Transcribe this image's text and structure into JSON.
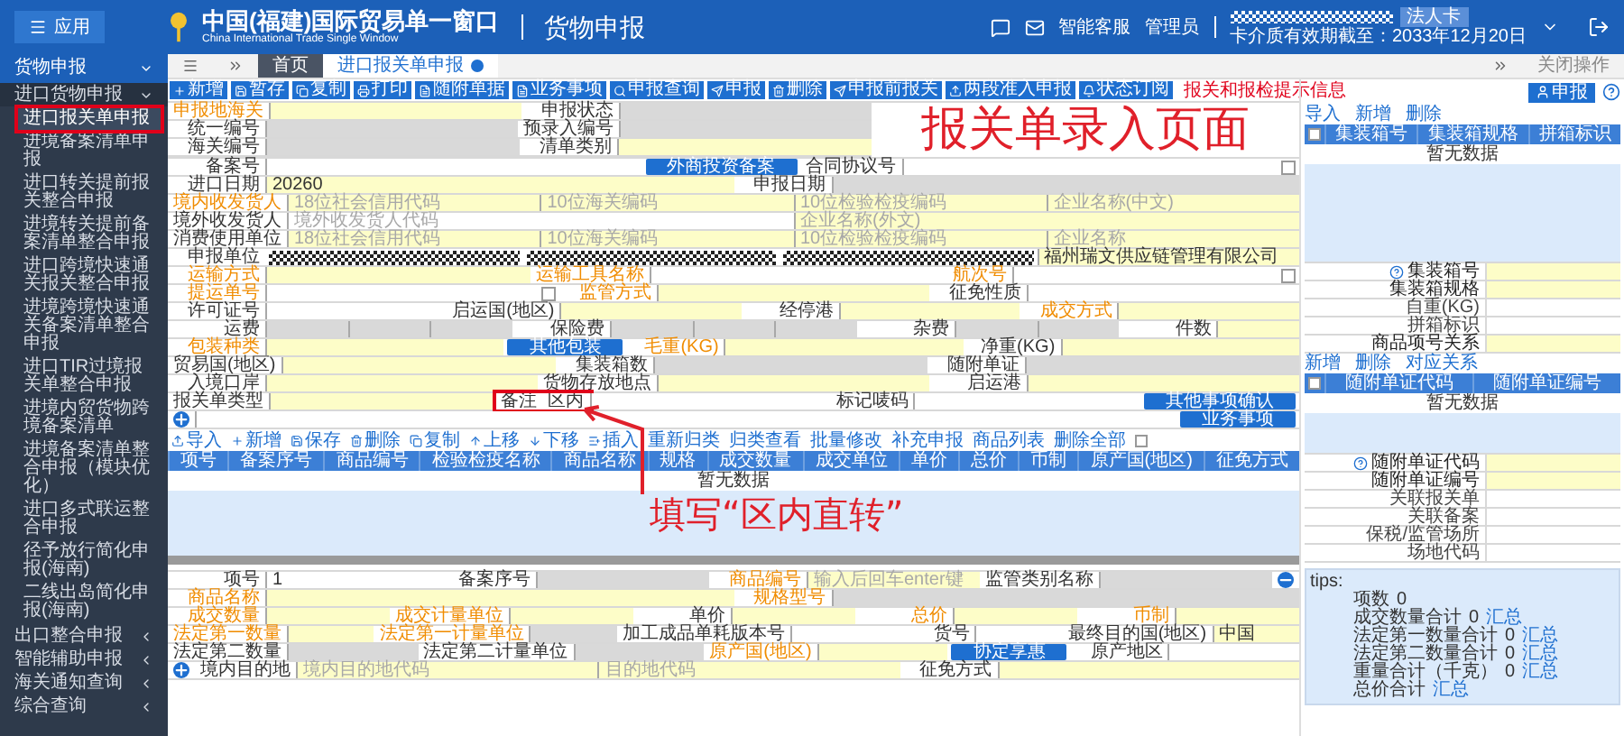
{
  "header": {
    "menu_button": "应用",
    "title": "中国(福建)国际贸易单一窗口",
    "subtitle": "China International Trade Single Window",
    "module": "货物申报",
    "links": [
      "智能客服",
      "管理员"
    ],
    "user_badge": "法人卡",
    "expiry": "卡介质有效期截至：2033年12月20日"
  },
  "sidebar": {
    "title": "货物申报",
    "groups": [
      {
        "label": "进口货物申报",
        "expanded": true,
        "items": [
          {
            "label": "进口报关单申报",
            "selected": true,
            "highlight": true
          },
          {
            "label": "进境备案清单申报",
            "selected": false,
            "highlight": false
          },
          {
            "label": "进口转关提前报关整合申报",
            "selected": false,
            "highlight": false
          },
          {
            "label": "进境转关提前备案清单整合申报",
            "selected": false,
            "highlight": false
          },
          {
            "label": "进口跨境快速通关报关整合申报",
            "selected": false,
            "highlight": false
          },
          {
            "label": "进境跨境快速通关备案清单整合申报",
            "selected": false,
            "highlight": false
          },
          {
            "label": "进口TIR过境报关单整合申报",
            "selected": false,
            "highlight": false
          },
          {
            "label": "进境内贸货物跨境备案清单",
            "selected": false,
            "highlight": false
          },
          {
            "label": "进境备案清单整合申报（模块优化）",
            "selected": false,
            "highlight": false
          },
          {
            "label": "进口多式联运整合申报",
            "selected": false,
            "highlight": false
          },
          {
            "label": "径予放行简化申报(海南)",
            "selected": false,
            "highlight": false
          },
          {
            "label": "二线出岛简化申报(海南)",
            "selected": false,
            "highlight": false
          }
        ]
      },
      {
        "label": "出口整合申报",
        "expanded": false
      },
      {
        "label": "智能辅助申报",
        "expanded": false
      },
      {
        "label": "海关通知查询",
        "expanded": false
      },
      {
        "label": "综合查询",
        "expanded": false
      }
    ]
  },
  "tabs": [
    {
      "label": "首页",
      "selected": false,
      "closable": false
    },
    {
      "label": "进口报关单申报",
      "selected": true,
      "closable": true
    }
  ],
  "close_action": "关闭操作",
  "toolbar": [
    "新增",
    "暂存",
    "复制",
    "打印",
    "随附单据",
    "业务事项",
    "申报查询",
    "申报",
    "删除",
    "申报前报关",
    "两段准入申报",
    "状态订阅"
  ],
  "notice": "报关和报检提示信息",
  "form_rows": [
    [
      {
        "kind": "label",
        "text": "申报地海关",
        "required": true
      },
      {
        "kind": "field",
        "required": true,
        "disabled": false
      },
      {
        "kind": "label",
        "text": "申报状态",
        "required": false
      },
      {
        "kind": "field",
        "required": false,
        "disabled": true
      }
    ],
    [
      {
        "kind": "label",
        "text": "统一编号",
        "required": false
      },
      {
        "kind": "field",
        "required": false,
        "disabled": true
      },
      {
        "kind": "label",
        "text": "预录入编号",
        "required": false
      },
      {
        "kind": "field",
        "required": false,
        "disabled": true
      }
    ],
    [
      {
        "kind": "label",
        "text": "海关编号",
        "required": false
      },
      {
        "kind": "field",
        "required": false,
        "disabled": true
      },
      {
        "kind": "label",
        "text": "清单类别",
        "required": false
      },
      {
        "kind": "field",
        "required": true,
        "disabled": false
      }
    ],
    [
      {
        "kind": "label",
        "text": "备案号",
        "required": false
      },
      {
        "kind": "field",
        "required": false,
        "disabled": false
      },
      {
        "kind": "button",
        "text": "外商投资备案"
      },
      {
        "kind": "label",
        "text": "合同协议号",
        "required": false
      },
      {
        "kind": "field",
        "required": false,
        "disabled": false
      },
      {
        "kind": "checkbox",
        "checked": false
      }
    ],
    [
      {
        "kind": "label",
        "text": "进口日期",
        "required": false
      },
      {
        "kind": "field",
        "required": true,
        "disabled": false,
        "value": "20260"
      },
      {
        "kind": "label",
        "text": "申报日期",
        "required": false
      },
      {
        "kind": "field",
        "required": false,
        "disabled": true
      }
    ],
    [
      {
        "kind": "label",
        "text": "境内收发货人",
        "required": true
      },
      {
        "kind": "field",
        "required": true,
        "disabled": false,
        "placeholder": "18位社会信用代码"
      },
      {
        "kind": "field",
        "required": true,
        "disabled": false,
        "placeholder": "10位海关编码"
      },
      {
        "kind": "field",
        "required": true,
        "disabled": false,
        "placeholder": "10位检验检疫编码"
      },
      {
        "kind": "field",
        "required": true,
        "disabled": false,
        "placeholder": "企业名称(中文)"
      }
    ],
    [
      {
        "kind": "label",
        "text": "境外收发货人",
        "required": false
      },
      {
        "kind": "field",
        "required": false,
        "disabled": false,
        "placeholder": "境外收发货人代码"
      },
      {
        "kind": "field",
        "required": true,
        "disabled": false,
        "placeholder": "企业名称(外文)"
      }
    ],
    [
      {
        "kind": "label",
        "text": "消费使用单位",
        "required": false
      },
      {
        "kind": "field",
        "required": true,
        "disabled": false,
        "placeholder": "18位社会信用代码"
      },
      {
        "kind": "field",
        "required": true,
        "disabled": false,
        "placeholder": "10位海关编码"
      },
      {
        "kind": "field",
        "required": true,
        "disabled": false,
        "placeholder": "10位检验检疫编码"
      },
      {
        "kind": "field",
        "required": true,
        "disabled": false,
        "placeholder": "企业名称"
      }
    ],
    [
      {
        "kind": "label",
        "text": "申报单位",
        "required": false
      },
      {
        "kind": "mask"
      },
      {
        "kind": "mask"
      },
      {
        "kind": "mask"
      },
      {
        "kind": "field",
        "required": true,
        "disabled": false,
        "value": "福州瑞文供应链管理有限公司"
      }
    ],
    [
      {
        "kind": "label",
        "text": "运输方式",
        "required": true
      },
      {
        "kind": "field",
        "required": true,
        "disabled": false
      },
      {
        "kind": "label",
        "text": "运输工具名称",
        "required": true
      },
      {
        "kind": "field",
        "required": false,
        "disabled": false
      },
      {
        "kind": "label",
        "text": "航次号",
        "required": true
      },
      {
        "kind": "field",
        "required": false,
        "disabled": false
      },
      {
        "kind": "checkbox",
        "checked": false
      }
    ],
    [
      {
        "kind": "label",
        "text": "提运单号",
        "required": true
      },
      {
        "kind": "field",
        "required": false,
        "disabled": false
      },
      {
        "kind": "checkbox",
        "checked": false
      },
      {
        "kind": "label",
        "text": "监管方式",
        "required": true
      },
      {
        "kind": "field",
        "required": true,
        "disabled": false
      },
      {
        "kind": "label",
        "text": "征免性质",
        "required": false
      },
      {
        "kind": "field",
        "required": false,
        "disabled": false
      }
    ],
    [
      {
        "kind": "label",
        "text": "许可证号",
        "required": false
      },
      {
        "kind": "field",
        "required": false,
        "disabled": false
      },
      {
        "kind": "label",
        "text": "启运国(地区)",
        "required": false
      },
      {
        "kind": "field",
        "required": true,
        "disabled": false
      },
      {
        "kind": "label",
        "text": "经停港",
        "required": false
      },
      {
        "kind": "field",
        "required": true,
        "disabled": false
      },
      {
        "kind": "label",
        "text": "成交方式",
        "required": true
      },
      {
        "kind": "field",
        "required": true,
        "disabled": false
      }
    ],
    [
      {
        "kind": "label",
        "text": "运费",
        "required": false
      },
      {
        "kind": "field",
        "required": false,
        "disabled": true
      },
      {
        "kind": "field",
        "required": false,
        "disabled": true
      },
      {
        "kind": "field",
        "required": false,
        "disabled": true
      },
      {
        "kind": "label",
        "text": "保险费",
        "required": false
      },
      {
        "kind": "field",
        "required": false,
        "disabled": true
      },
      {
        "kind": "field",
        "required": false,
        "disabled": true
      },
      {
        "kind": "field",
        "required": false,
        "disabled": true
      },
      {
        "kind": "label",
        "text": "杂费",
        "required": false
      },
      {
        "kind": "field",
        "required": false,
        "disabled": true
      },
      {
        "kind": "field",
        "required": false,
        "disabled": true
      },
      {
        "kind": "label",
        "text": "件数",
        "required": false
      },
      {
        "kind": "field",
        "required": true,
        "disabled": false
      }
    ],
    [
      {
        "kind": "label",
        "text": "包装种类",
        "required": true
      },
      {
        "kind": "field",
        "required": true,
        "disabled": false
      },
      {
        "kind": "button",
        "text": "其他包装"
      },
      {
        "kind": "label",
        "text": "毛重(KG)",
        "required": true
      },
      {
        "kind": "field",
        "required": true,
        "disabled": false
      },
      {
        "kind": "label",
        "text": "净重(KG)",
        "required": false
      },
      {
        "kind": "field",
        "required": true,
        "disabled": false
      }
    ],
    [
      {
        "kind": "label",
        "text": "贸易国(地区)",
        "required": false
      },
      {
        "kind": "field",
        "required": true,
        "disabled": false
      },
      {
        "kind": "label",
        "text": "集装箱数",
        "required": false
      },
      {
        "kind": "field",
        "required": false,
        "disabled": true
      },
      {
        "kind": "label",
        "text": "随附单证",
        "required": false
      },
      {
        "kind": "field",
        "required": false,
        "disabled": true
      }
    ],
    [
      {
        "kind": "label",
        "text": "入境口岸",
        "required": false
      },
      {
        "kind": "field",
        "required": true,
        "disabled": false
      },
      {
        "kind": "label",
        "text": "货物存放地点",
        "required": false
      },
      {
        "kind": "field",
        "required": true,
        "disabled": false
      },
      {
        "kind": "label",
        "text": "启运港",
        "required": false
      },
      {
        "kind": "field",
        "required": true,
        "disabled": false
      }
    ],
    [
      {
        "kind": "label",
        "text": "报关单类型",
        "required": false
      },
      {
        "kind": "field",
        "required": true,
        "disabled": false
      },
      {
        "kind": "note",
        "text": "备注",
        "value": "区内",
        "highlight": true
      },
      {
        "kind": "field",
        "required": false,
        "disabled": false
      },
      {
        "kind": "label",
        "text": "标记唛码",
        "required": false
      },
      {
        "kind": "field",
        "required": false,
        "disabled": false
      },
      {
        "kind": "button",
        "text": "其他事项确认"
      }
    ],
    [
      {
        "kind": "add"
      },
      {
        "kind": "field",
        "required": false,
        "disabled": false
      },
      {
        "kind": "button",
        "text": "业务事项"
      }
    ]
  ],
  "items_toolbar": [
    "导入",
    "新增",
    "保存",
    "删除",
    "复制",
    "上移",
    "下移",
    "插入",
    "重新归类",
    "归类查看",
    "批量修改",
    "补充申报",
    "商品列表",
    "删除全部"
  ],
  "items_toolbar_checked": false,
  "items_table": {
    "columns": [
      "项号",
      "备案序号",
      "商品编号",
      "检验检疫名称",
      "商品名称",
      "规格",
      "成交数量",
      "成交单位",
      "单价",
      "总价",
      "币制",
      "原产国(地区)",
      "征免方式"
    ],
    "empty": "暂无数据"
  },
  "item_form_rows": [
    [
      {
        "kind": "label",
        "text": "项号",
        "required": false
      },
      {
        "kind": "field",
        "required": false,
        "disabled": false,
        "value": "1"
      },
      {
        "kind": "label",
        "text": "备案序号",
        "required": false
      },
      {
        "kind": "field",
        "required": false,
        "disabled": true
      },
      {
        "kind": "label",
        "text": "商品编号",
        "required": true
      },
      {
        "kind": "field",
        "required": true,
        "disabled": false,
        "placeholder": "输入后回车enter键"
      },
      {
        "kind": "label",
        "text": "监管类别名称",
        "required": false
      },
      {
        "kind": "field",
        "required": false,
        "disabled": true
      },
      {
        "kind": "remove"
      }
    ],
    [
      {
        "kind": "label",
        "text": "商品名称",
        "required": true
      },
      {
        "kind": "field",
        "required": true,
        "disabled": false
      },
      {
        "kind": "label",
        "text": "规格型号",
        "required": true
      },
      {
        "kind": "field",
        "required": false,
        "disabled": true
      }
    ],
    [
      {
        "kind": "label",
        "text": "成交数量",
        "required": true
      },
      {
        "kind": "field",
        "required": true,
        "disabled": false
      },
      {
        "kind": "label",
        "text": "成交计量单位",
        "required": true
      },
      {
        "kind": "field",
        "required": true,
        "disabled": false
      },
      {
        "kind": "label",
        "text": "单价",
        "required": false
      },
      {
        "kind": "field",
        "required": true,
        "disabled": false
      },
      {
        "kind": "label",
        "text": "总价",
        "required": true
      },
      {
        "kind": "field",
        "required": true,
        "disabled": false
      },
      {
        "kind": "label",
        "text": "币制",
        "required": true
      },
      {
        "kind": "field",
        "required": true,
        "disabled": false
      }
    ],
    [
      {
        "kind": "label",
        "text": "法定第一数量",
        "required": true
      },
      {
        "kind": "field",
        "required": true,
        "disabled": false
      },
      {
        "kind": "label",
        "text": "法定第一计量单位",
        "required": true
      },
      {
        "kind": "field",
        "required": false,
        "disabled": true
      },
      {
        "kind": "label",
        "text": "加工成品单耗版本号",
        "required": false
      },
      {
        "kind": "field",
        "required": false,
        "disabled": false
      },
      {
        "kind": "label",
        "text": "货号",
        "required": false
      },
      {
        "kind": "field",
        "required": false,
        "disabled": false
      },
      {
        "kind": "label",
        "text": "最终目的国(地区)",
        "required": false
      },
      {
        "kind": "field",
        "required": true,
        "disabled": false,
        "value": "中国"
      }
    ],
    [
      {
        "kind": "label",
        "text": "法定第二数量",
        "required": false
      },
      {
        "kind": "field",
        "required": false,
        "disabled": true
      },
      {
        "kind": "label",
        "text": "法定第二计量单位",
        "required": false
      },
      {
        "kind": "field",
        "required": false,
        "disabled": true
      },
      {
        "kind": "label",
        "text": "原产国(地区)",
        "required": true
      },
      {
        "kind": "field",
        "required": true,
        "disabled": false
      },
      {
        "kind": "button",
        "text": "协定享惠"
      },
      {
        "kind": "label",
        "text": "原产地区",
        "required": false
      },
      {
        "kind": "field",
        "required": false,
        "disabled": false
      }
    ],
    [
      {
        "kind": "add"
      },
      {
        "kind": "label",
        "text": "境内目的地",
        "required": false
      },
      {
        "kind": "field",
        "required": true,
        "disabled": false,
        "placeholder": "境内目的地代码"
      },
      {
        "kind": "field",
        "required": true,
        "disabled": false,
        "placeholder": "目的地代码"
      },
      {
        "kind": "label",
        "text": "征免方式",
        "required": false
      },
      {
        "kind": "field",
        "required": true,
        "disabled": false
      }
    ]
  ],
  "declare_button": "申报",
  "container_toolbar": [
    "导入",
    "新增",
    "删除"
  ],
  "container_table": {
    "checked": false,
    "columns": [
      "集装箱号",
      "集装箱规格",
      "拼箱标识"
    ],
    "empty": "暂无数据"
  },
  "container_fields": [
    {
      "label": "集装箱号",
      "help": true,
      "required": true
    },
    {
      "label": "集装箱规格",
      "help": false,
      "required": true
    },
    {
      "label": "自重(KG)",
      "help": false,
      "required": false
    },
    {
      "label": "拼箱标识",
      "help": false,
      "required": false
    },
    {
      "label": "商品项号关系",
      "help": false,
      "required": true
    }
  ],
  "document_toolbar": [
    "新增",
    "删除",
    "对应关系"
  ],
  "document_table": {
    "checked": false,
    "columns": [
      "随附单证代码",
      "随附单证编号"
    ],
    "empty": "暂无数据"
  },
  "document_fields": [
    {
      "label": "随附单证代码",
      "help": true,
      "required": true
    },
    {
      "label": "随附单证编号",
      "help": false,
      "required": true
    },
    {
      "label": "关联报关单",
      "help": false,
      "required": false
    },
    {
      "label": "关联备案",
      "help": false,
      "required": false
    },
    {
      "label": "保税/监管场所",
      "help": false,
      "required": false
    },
    {
      "label": "场地代码",
      "help": false,
      "required": false
    }
  ],
  "tips": {
    "title": "tips:",
    "lines": [
      {
        "label": "项数",
        "value": "0"
      },
      {
        "label": "成交数量合计",
        "value": "0",
        "link": "汇总"
      },
      {
        "label": "法定第一数量合计",
        "value": "0",
        "link": "汇总"
      },
      {
        "label": "法定第二数量合计",
        "value": "0",
        "link": "汇总"
      },
      {
        "label": "重量合计（千克）",
        "value": "0",
        "link": "汇总"
      },
      {
        "label": "总价合计",
        "link": "汇总"
      }
    ]
  },
  "annotations": {
    "page_title": "报关单录入页面",
    "hint": "填写“区内直转”"
  }
}
